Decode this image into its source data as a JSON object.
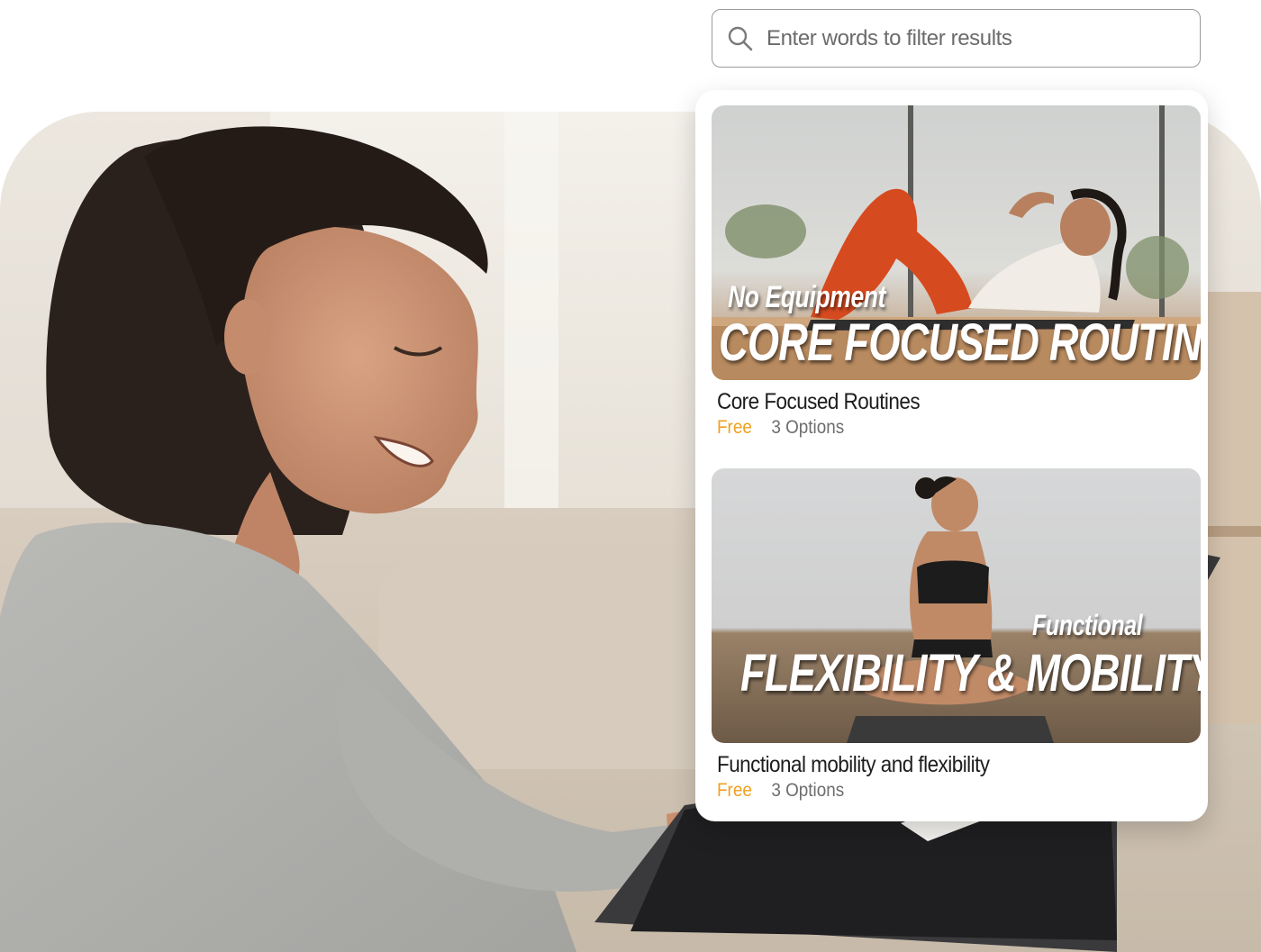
{
  "search": {
    "placeholder": "Enter words to filter results",
    "icon": "search-icon"
  },
  "results": [
    {
      "thumbnail_subtitle": "No Equipment",
      "thumbnail_title": "CORE FOCUSED ROUTINES",
      "title": "Core Focused Routines",
      "price": "Free",
      "options": "3 Options"
    },
    {
      "thumbnail_subtitle": "Functional",
      "thumbnail_title": "FLEXIBILITY & MOBILITY",
      "title": "Functional mobility and flexibility",
      "price": "Free",
      "options": "3 Options"
    }
  ],
  "colors": {
    "price": "#f0a020",
    "options": "#6e6e6e",
    "title": "#1d1d1d"
  }
}
